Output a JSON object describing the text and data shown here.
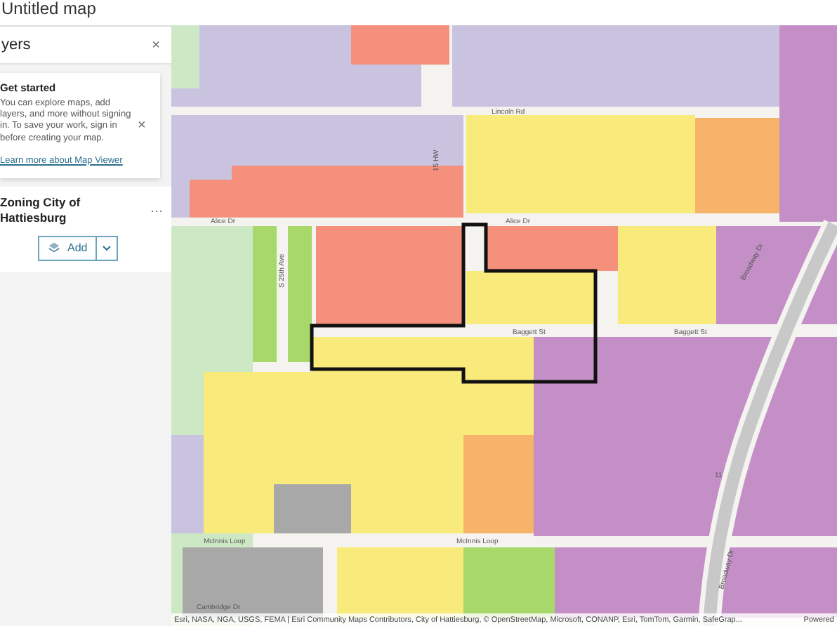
{
  "window": {
    "title": "Untitled map"
  },
  "panel": {
    "title": "yers",
    "close": "×"
  },
  "notice": {
    "title": "Get started",
    "body": "You can explore maps, add layers, and more without signing in. To save your work, sign in before creating your map.",
    "link": "Learn more about Map Viewer",
    "close": "×"
  },
  "layers": [
    {
      "name": "Zoning City of Hattiesburg",
      "menu": "···"
    }
  ],
  "add_button": {
    "label": "Add"
  },
  "map": {
    "street_labels": [
      "Lincoln Rd",
      "15 HW",
      "Alice Dr",
      "Alice Dr",
      "S 25th Ave",
      "Baggett St",
      "Baggett St",
      "Broadway Dr",
      "Broadway Dr",
      "11",
      "McInnis Loop",
      "McInnis Loop",
      "Cambridge Dr"
    ],
    "attribution": "Esri, NASA, NGA, USGS, FEMA | Esri Community Maps Contributors, City of Hattiesburg, © OpenStreetMap, Microsoft, CONANP, Esri, TomTom, Garmin, SafeGrap...",
    "powered": "Powered"
  }
}
